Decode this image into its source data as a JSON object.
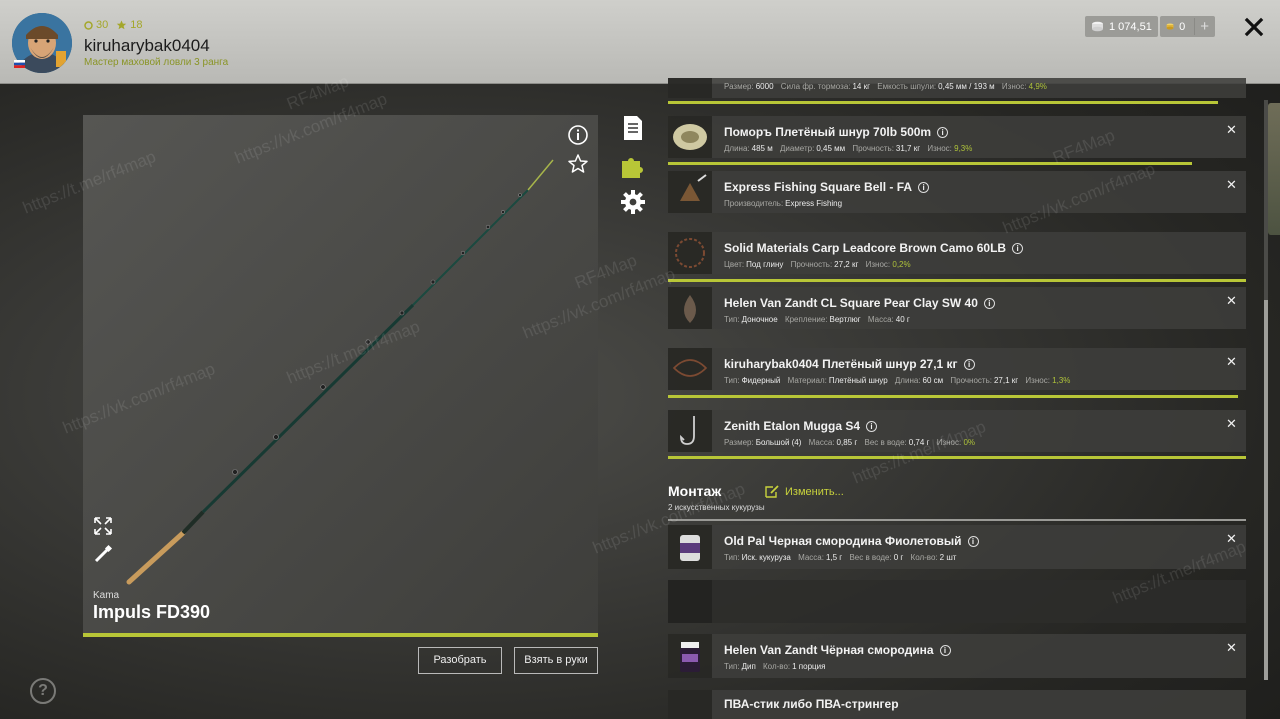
{
  "header": {
    "currency_circle": "30",
    "currency_star": "18",
    "username": "kiruharybak0404",
    "rank_title": "Мастер маховой ловли 3 ранга",
    "money_silver": "1 074,51",
    "money_gold": "0",
    "add_label": "+"
  },
  "rod": {
    "brand": "Kama",
    "name": "Impuls FD390",
    "disassemble_label": "Разобрать",
    "take_label": "Взять в руки",
    "help_label": "?"
  },
  "tackle_items": [
    {
      "title": "",
      "meta": [
        [
          "Размер:",
          "6000"
        ],
        [
          "Сила фр. тормоза:",
          "14 кг"
        ],
        [
          "Емкость шпули:",
          "0,45 мм / 193 м"
        ]
      ],
      "wear_label": "Износ:",
      "wear": "4,9%"
    },
    {
      "title": "Поморъ Плетёный шнур 70lb 500m",
      "meta": [
        [
          "Длина:",
          "485 м"
        ],
        [
          "Диаметр:",
          "0,45 мм"
        ],
        [
          "Прочность:",
          "31,7 кг"
        ]
      ],
      "wear_label": "Износ:",
      "wear": "9,3%"
    },
    {
      "title": "Express Fishing Square Bell - FA",
      "meta": [
        [
          "Производитель:",
          "Express Fishing"
        ]
      ]
    },
    {
      "title": "Solid Materials Carp Leadcore Brown Camo 60LB",
      "meta": [
        [
          "Цвет:",
          "Под глину"
        ],
        [
          "Прочность:",
          "27,2 кг"
        ]
      ],
      "wear_label": "Износ:",
      "wear": "0,2%"
    },
    {
      "title": "Helen Van Zandt CL Square Pear Clay SW 40",
      "meta": [
        [
          "Тип:",
          "Доночное"
        ],
        [
          "Крепление:",
          "Вертлюг"
        ],
        [
          "Масса:",
          "40 г"
        ]
      ]
    },
    {
      "title": "kiruharybak0404 Плетёный шнур 27,1 кг",
      "meta": [
        [
          "Тип:",
          "Фидерный"
        ],
        [
          "Материал:",
          "Плетёный шнур"
        ],
        [
          "Длина:",
          "60 см"
        ],
        [
          "Прочность:",
          "27,1 кг"
        ]
      ],
      "wear_label": "Износ:",
      "wear": "1,3%"
    },
    {
      "title": "Zenith Etalon Mugga S4",
      "meta": [
        [
          "Размер:",
          "Большой (4)"
        ],
        [
          "Масса:",
          "0,85 г"
        ],
        [
          "Вес в воде:",
          "0,74 г"
        ]
      ],
      "wear_label": "Износ:",
      "wear": "0%"
    }
  ],
  "montage": {
    "title": "Монтаж",
    "edit_label": "Изменить...",
    "subtitle": "2 искусственных кукурузы"
  },
  "bait_items": [
    {
      "title": "Old Pal Черная смородина Фиолетовый",
      "meta": [
        [
          "Тип:",
          "Иск. кукуруза"
        ],
        [
          "Масса:",
          "1,5 г"
        ],
        [
          "Вес в воде:",
          "0 г"
        ],
        [
          "Кол-во:",
          "2 шт"
        ]
      ]
    },
    {
      "title": "Helen Van Zandt Чёрная смородина",
      "meta": [
        [
          "Тип:",
          "Дип"
        ],
        [
          "Кол-во:",
          "1 порция"
        ]
      ]
    },
    {
      "title": "ПВА-стик либо ПВА-стрингер",
      "meta": []
    }
  ],
  "watermarks": [
    "RF4Map",
    "https://vk.com/rf4map",
    "https://t.me/rf4map"
  ],
  "colors": {
    "accent": "#b8c637",
    "wear": "#aec23a",
    "topbar": "#c4c4c0"
  }
}
